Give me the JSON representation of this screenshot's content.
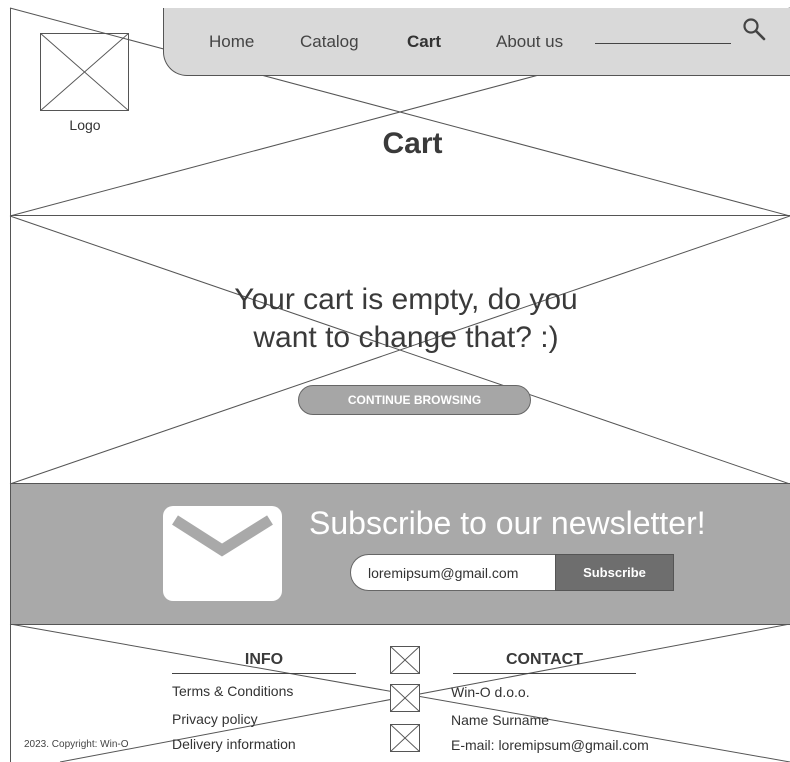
{
  "header": {
    "logo_label": "Logo",
    "nav": [
      "Home",
      "Catalog",
      "Cart",
      "About us"
    ],
    "active_nav": "Cart",
    "search_icon": "search-icon"
  },
  "main": {
    "title": "Cart",
    "empty_message": "Your cart is empty, do you want to change that? :)",
    "continue_label": "CONTINUE BROWSING"
  },
  "newsletter": {
    "icon": "envelope-icon",
    "title": "Subscribe to our newsletter!",
    "email_value": "loremipsum@gmail.com",
    "subscribe_label": "Subscribe"
  },
  "footer": {
    "info_title": "INFO",
    "info_links": [
      "Terms & Conditions",
      "Privacy policy",
      "Delivery information"
    ],
    "contact_title": "CONTACT",
    "contact_lines": [
      "Win-O d.o.o.",
      "Name Surname",
      "E-mail: loremipsum@gmail.com"
    ],
    "copyright": "2023. Copyright: Win-O",
    "social_icons": [
      "social-icon-1",
      "social-icon-2",
      "social-icon-3"
    ]
  },
  "colors": {
    "nav_bg": "#d9d9d9",
    "newsletter_bg": "#a9a9a9",
    "button_gray": "#a6a6a6",
    "subscribe_bg": "#6e6e6e"
  }
}
